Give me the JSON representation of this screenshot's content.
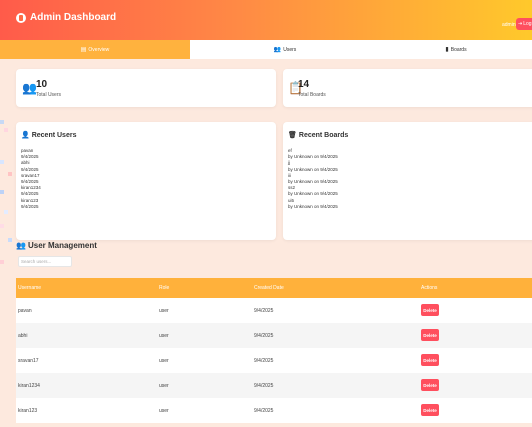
{
  "header": {
    "title": "Admin Dashboard",
    "admin_label": "admin",
    "logout_label": "Log"
  },
  "tabs": [
    {
      "label": "Overview",
      "icon": "chart-icon",
      "active": true
    },
    {
      "label": "Users",
      "icon": "users-icon",
      "active": false
    },
    {
      "label": "Boards",
      "icon": "board-icon",
      "active": false
    }
  ],
  "stats": {
    "users": {
      "value": "10",
      "label": "Total Users",
      "icon": "users-icon"
    },
    "boards": {
      "value": "14",
      "label": "Total Boards",
      "icon": "clipboard-icon"
    }
  },
  "recent_users": {
    "title": "Recent Users",
    "lines": [
      "pavan",
      "9/4/2025",
      "abhi",
      "9/4/2025",
      "sravan17",
      "9/4/2025",
      "kiran1234",
      "9/4/2025",
      "kiran123",
      "9/4/2025"
    ]
  },
  "recent_boards": {
    "title": "Recent Boards",
    "lines": [
      "ef",
      "by Unknown on 9/4/2025",
      "jj",
      "by Unknown on 9/4/2025",
      "iii",
      "by Unknown on 9/4/2025",
      "ss2",
      "by Unknown on 9/4/2025",
      "ui5",
      "by Unknown on 9/4/2025"
    ]
  },
  "user_management": {
    "title": "User Management",
    "search_placeholder": "Search users...",
    "columns": [
      "Username",
      "Role",
      "Created Date",
      "Actions"
    ],
    "rows": [
      {
        "username": "pavan",
        "role": "user",
        "created": "9/4/2025",
        "action": "Delete"
      },
      {
        "username": "abhi",
        "role": "user",
        "created": "9/4/2025",
        "action": "Delete"
      },
      {
        "username": "sravan17",
        "role": "user",
        "created": "9/4/2025",
        "action": "Delete"
      },
      {
        "username": "kiran1234",
        "role": "user",
        "created": "9/4/2025",
        "action": "Delete"
      },
      {
        "username": "kiran123",
        "role": "user",
        "created": "9/4/2025",
        "action": "Delete"
      }
    ]
  },
  "colors": {
    "header_gradient_start": "#ff5b4a",
    "header_gradient_end": "#ffc92b",
    "accent": "#ffb13b",
    "danger": "#ff4f5e"
  }
}
